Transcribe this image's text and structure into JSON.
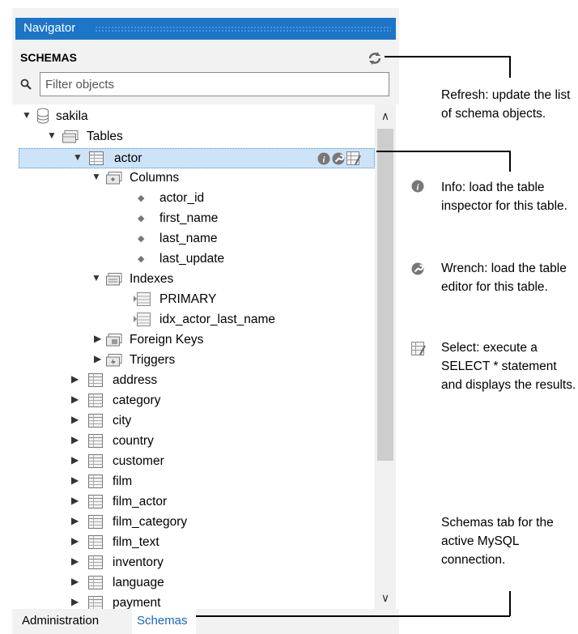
{
  "navigator": {
    "title": "Navigator",
    "schemas_header": "SCHEMAS",
    "filter_placeholder": "Filter objects",
    "tree": {
      "schema": "sakila",
      "tables_node": "Tables",
      "selected_table": "actor",
      "columns_node": "Columns",
      "columns": [
        "actor_id",
        "first_name",
        "last_name",
        "last_update"
      ],
      "indexes_node": "Indexes",
      "indexes": [
        "PRIMARY",
        "idx_actor_last_name"
      ],
      "foreign_keys_node": "Foreign Keys",
      "triggers_node": "Triggers",
      "other_tables": [
        "address",
        "category",
        "city",
        "country",
        "customer",
        "film",
        "film_actor",
        "film_category",
        "film_text",
        "inventory",
        "language",
        "payment"
      ]
    },
    "tabs": {
      "administration": "Administration",
      "schemas": "Schemas"
    }
  },
  "annotations": {
    "refresh": "Refresh: update the list of schema objects.",
    "info": "Info: load the table inspector for this table.",
    "wrench": "Wrench: load the table editor for this table.",
    "select": "Select: execute a SELECT * statement and displays the results.",
    "schemas_tab": "Schemas tab for the active MySQL connection."
  },
  "colors": {
    "titlebar": "#1c75c7",
    "selection": "#cde3f7",
    "tab_text": "#1a65c0"
  }
}
